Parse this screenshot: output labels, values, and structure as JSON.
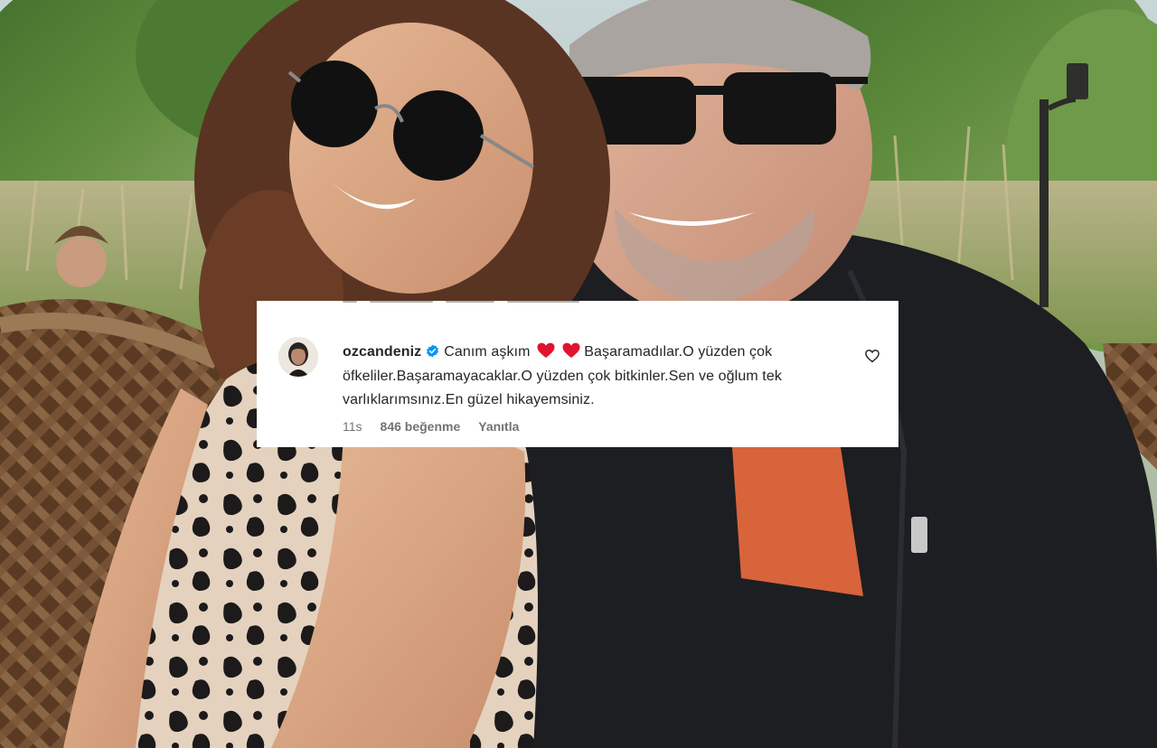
{
  "comment": {
    "username": "ozcandeniz",
    "text_part1": "Canım aşkım",
    "text_part2": "Başaramadılar.O yüzden çok öfkeliler.Başaramayacaklar.O yüzden çok bitkinler.Sen ve oğlum tek varlıklarımsınız.En güzel hikayemsiniz.",
    "time": "11s",
    "likes": "846 beğenme",
    "reply_label": "Yanıtla"
  },
  "icons": {
    "verified": "verified-badge-icon",
    "heart_emoji": "red-heart-emoji-icon",
    "like": "heart-outline-icon"
  },
  "colors": {
    "verified_blue": "#0095f6",
    "heart_red": "#e0142e",
    "text_primary": "#262626",
    "text_secondary": "#737373"
  }
}
